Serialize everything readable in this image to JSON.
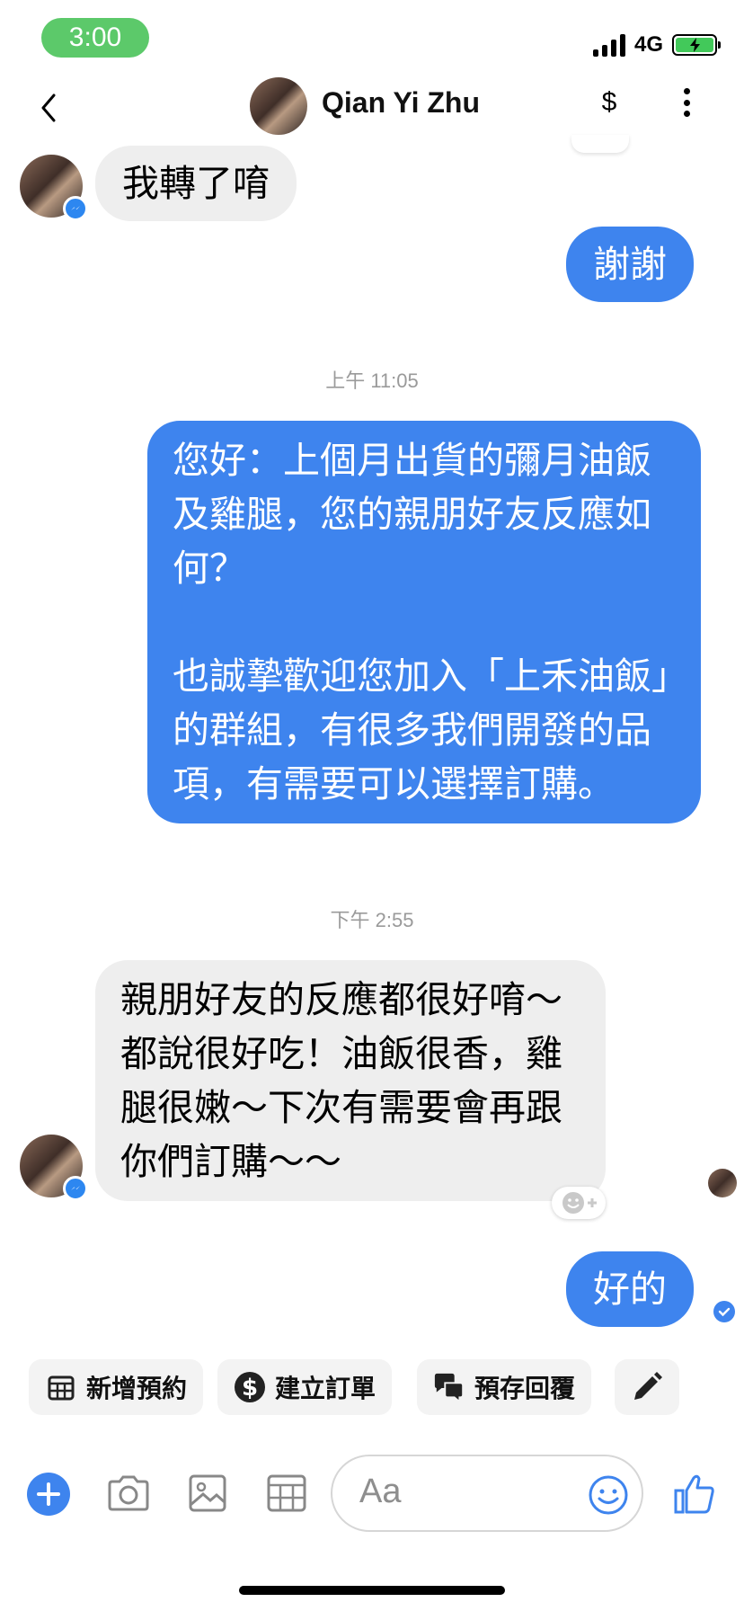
{
  "status_bar": {
    "time": "3:00",
    "network": "4G"
  },
  "header": {
    "contact_name": "Qian Yi Zhu",
    "pay_symbol": "$"
  },
  "messages": [
    {
      "from": "contact",
      "text": "我轉了唷"
    },
    {
      "from": "me",
      "text": "謝謝"
    },
    {
      "timestamp": "上午 11:05"
    },
    {
      "from": "me",
      "text": "您好：上個月出貨的彌月油飯及雞腿，您的親朋好友反應如何？\n\n也誠摯歡迎您加入「上禾油飯」的群組，有很多我們開發的品項，有需要可以選擇訂購。"
    },
    {
      "timestamp": "下午 2:55"
    },
    {
      "from": "contact",
      "text": "親朋好友的反應都很好唷～都說很好吃！油飯很香，雞腿很嫩～下次有需要會再跟你們訂購～～"
    },
    {
      "from": "me",
      "text": "好的"
    }
  ],
  "quick_actions": [
    {
      "label": "新增預約",
      "icon": "calendar-icon"
    },
    {
      "label": "建立訂單",
      "icon": "dollar-circle-icon"
    },
    {
      "label": "預存回覆",
      "icon": "chat-bubbles-icon"
    },
    {
      "label": "",
      "icon": "pencil-icon"
    }
  ],
  "composer": {
    "placeholder": "Aa"
  },
  "colors": {
    "outgoing": "#3e84ee",
    "incoming": "#eeeeee",
    "status_time_bg": "#5cc96a"
  }
}
